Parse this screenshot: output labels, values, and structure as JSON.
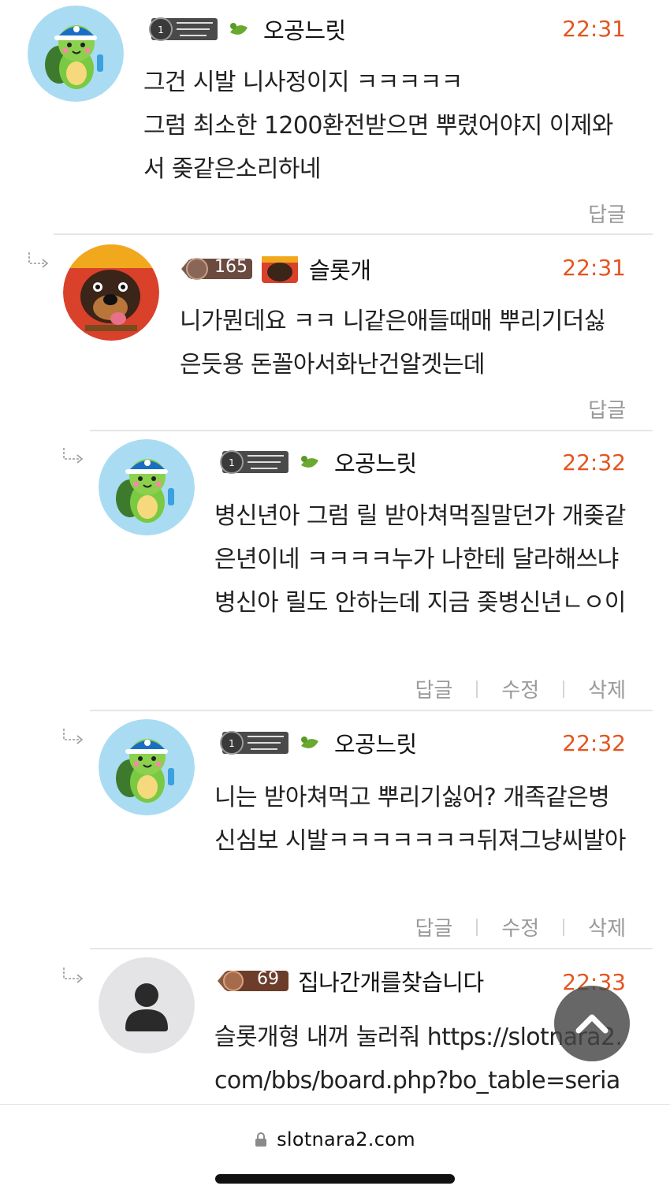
{
  "comments": [
    {
      "nickname": "오공느릿",
      "time": "22:31",
      "text": "그건 시발 니사정이지 ㅋㅋㅋㅋㅋ\n그럼 최소한 1200환전받으면 뿌렸어야지 이제와서 좆같은소리하네",
      "actions": [
        "답글"
      ],
      "avatar_icon": "turtle-avatar-icon",
      "level_icon": "level-badge-icon"
    },
    {
      "nickname": "슬롯개",
      "time": "22:31",
      "level": "165",
      "text": "니가뭔데요 ㅋㅋ 니같은애들때매 뿌리기더싫은듯용 돈꼴아서화난건알겟는데",
      "actions": [
        "답글"
      ],
      "avatar_icon": "dog-avatar-icon",
      "level_icon": "level-165-badge-icon"
    },
    {
      "nickname": "오공느릿",
      "time": "22:32",
      "text": "병신년아 그럼 릴 받아쳐먹질말던가 개좆같은년이네 ㅋㅋㅋㅋ누가 나한테 달라해쓰냐 병신아 릴도 안하는데 지금 좆병신년ㄴㅇ이",
      "actions": [
        "답글",
        "수정",
        "삭제"
      ],
      "avatar_icon": "turtle-avatar-icon",
      "level_icon": "level-badge-icon"
    },
    {
      "nickname": "오공느릿",
      "time": "22:32",
      "text": "니는 받아쳐먹고 뿌리기싫어? 개족같은병신심보 시발ㅋㅋㅋㅋㅋㅋㅋ뒤져그냥씨발아",
      "actions": [
        "답글",
        "수정",
        "삭제"
      ],
      "avatar_icon": "turtle-avatar-icon",
      "level_icon": "level-badge-icon"
    },
    {
      "nickname": "집나간개를찾습니다",
      "time": "22:33",
      "level": "69",
      "text": "슬롯개형 내꺼 눌러줘 https://slotnara2.com/bbs/board.php?bo_table=seria",
      "actions": [],
      "avatar_icon": "default-user-icon",
      "level_icon": "level-69-badge-icon"
    }
  ],
  "browser": {
    "url": "slotnara2.com"
  },
  "colors": {
    "time": "#e4551f",
    "action": "#9a9a9a",
    "divider": "#e6e6e6"
  }
}
